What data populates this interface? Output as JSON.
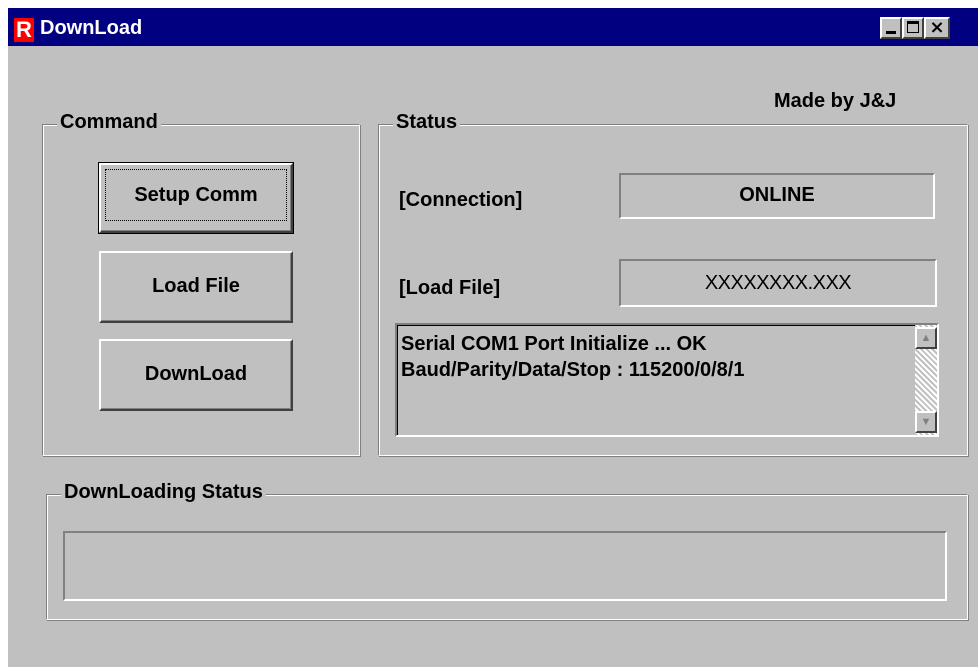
{
  "window": {
    "title": "DownLoad",
    "app_icon_letter": "R",
    "credit": "Made by J&J"
  },
  "titlebar_buttons": {
    "minimize_icon": "minimize-icon",
    "maximize_icon": "maximize-icon",
    "close_glyph": "×"
  },
  "command": {
    "group_label": "Command",
    "setup_comm_label": "Setup Comm",
    "load_file_label": "Load File",
    "download_label": "DownLoad"
  },
  "status": {
    "group_label": "Status",
    "connection_label": "[Connection]",
    "connection_value": "ONLINE",
    "load_file_label": "[Load File]",
    "load_file_value": "XXXXXXXX.XXX",
    "log_lines": [
      "Serial COM1 Port Initialize ... OK",
      "Baud/Parity/Data/Stop : 115200/0/8/1"
    ],
    "scroll_up_glyph": "▲",
    "scroll_down_glyph": "▼"
  },
  "downloading": {
    "group_label": "DownLoading Status",
    "progress": 0
  },
  "colors": {
    "titlebar": "#000080",
    "face": "#c0c0c0",
    "icon_red": "#ff0000"
  }
}
